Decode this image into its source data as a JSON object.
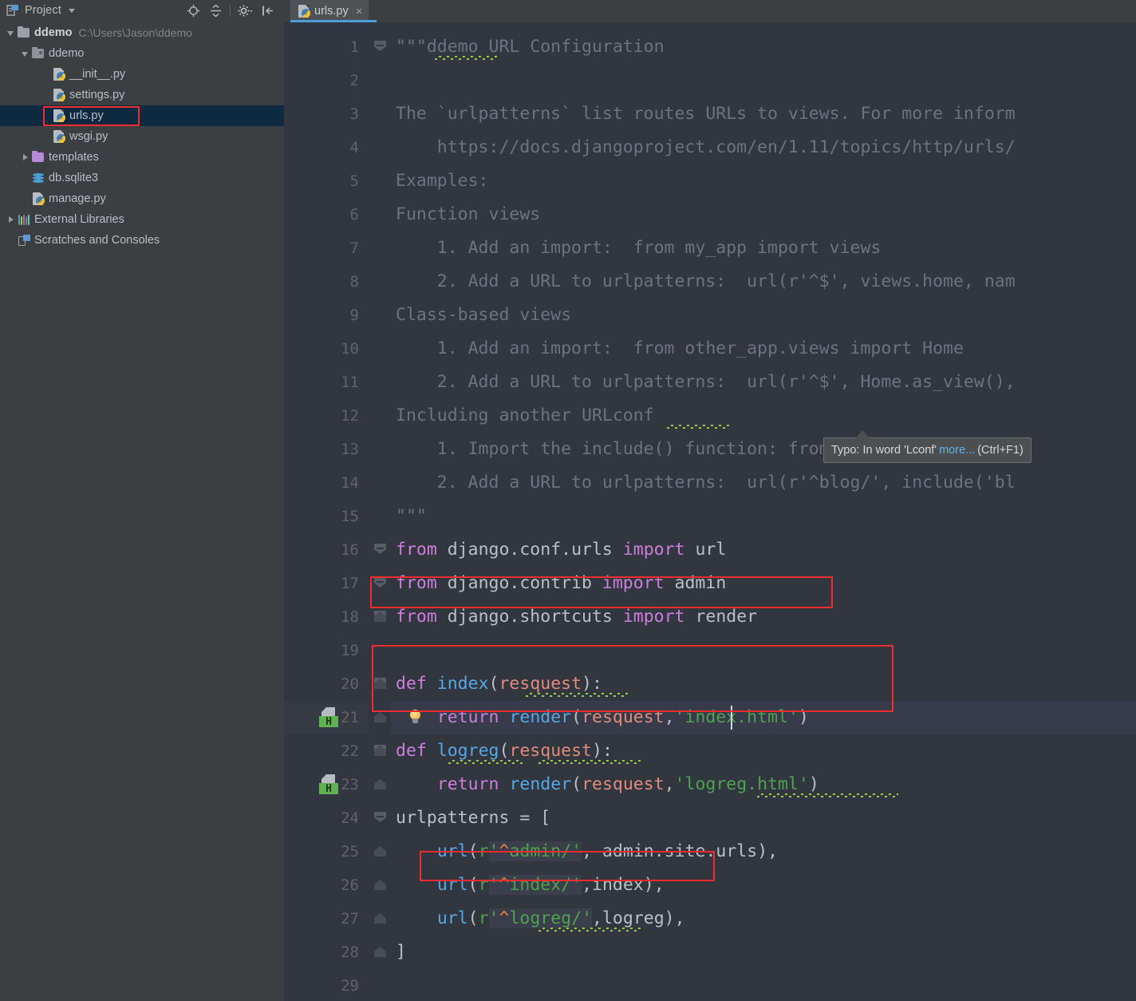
{
  "sidebar": {
    "header": {
      "title": "Project",
      "icon": "project-icon",
      "caret": "chevron-down-icon"
    },
    "toolbar_icons": [
      {
        "name": "locate-target-icon"
      },
      {
        "name": "collapse-all-icon"
      },
      {
        "name": "settings-gear-icon"
      },
      {
        "name": "hide-panel-icon"
      }
    ],
    "items": [
      {
        "label": "ddemo",
        "path": "C:\\Users\\Jason\\ddemo",
        "icon": "folder-icon",
        "indent": 0,
        "arrow": "down",
        "bold": true,
        "selected": false
      },
      {
        "label": "ddemo",
        "path": "",
        "icon": "module-folder-icon",
        "indent": 1,
        "arrow": "down",
        "bold": false,
        "selected": false
      },
      {
        "label": "__init__.py",
        "path": "",
        "icon": "python-file-icon",
        "indent": 2,
        "arrow": "none",
        "bold": false,
        "selected": false
      },
      {
        "label": "settings.py",
        "path": "",
        "icon": "python-file-icon",
        "indent": 2,
        "arrow": "none",
        "bold": false,
        "selected": false
      },
      {
        "label": "urls.py",
        "path": "",
        "icon": "python-file-icon",
        "indent": 2,
        "arrow": "none",
        "bold": false,
        "selected": true
      },
      {
        "label": "wsgi.py",
        "path": "",
        "icon": "python-file-icon",
        "indent": 2,
        "arrow": "none",
        "bold": false,
        "selected": false
      },
      {
        "label": "templates",
        "path": "",
        "icon": "templates-folder-icon",
        "indent": 1,
        "arrow": "right",
        "bold": false,
        "selected": false
      },
      {
        "label": "db.sqlite3",
        "path": "",
        "icon": "database-icon",
        "indent": 1,
        "arrow": "none",
        "bold": false,
        "selected": false
      },
      {
        "label": "manage.py",
        "path": "",
        "icon": "python-file-icon",
        "indent": 1,
        "arrow": "none",
        "bold": false,
        "selected": false
      },
      {
        "label": "External Libraries",
        "path": "",
        "icon": "libraries-icon",
        "indent": 0,
        "arrow": "right",
        "bold": false,
        "selected": false
      },
      {
        "label": "Scratches and Consoles",
        "path": "",
        "icon": "scratches-icon",
        "indent": 0,
        "arrow": "none",
        "bold": false,
        "selected": false
      }
    ]
  },
  "editor": {
    "tab": {
      "label": "urls.py",
      "icon": "python-file-icon",
      "close": "×"
    },
    "caret_line": 21,
    "lines": [
      {
        "n": 1,
        "text": "\"\"\"ddemo URL Configuration"
      },
      {
        "n": 2,
        "text": ""
      },
      {
        "n": 3,
        "text": "The `urlpatterns` list routes URLs to views. For more inform"
      },
      {
        "n": 4,
        "text": "    https://docs.djangoproject.com/en/1.11/topics/http/urls/"
      },
      {
        "n": 5,
        "text": "Examples:"
      },
      {
        "n": 6,
        "text": "Function views"
      },
      {
        "n": 7,
        "text": "    1. Add an import:  from my_app import views"
      },
      {
        "n": 8,
        "text": "    2. Add a URL to urlpatterns:  url(r'^$', views.home, nam"
      },
      {
        "n": 9,
        "text": "Class-based views"
      },
      {
        "n": 10,
        "text": "    1. Add an import:  from other_app.views import Home"
      },
      {
        "n": 11,
        "text": "    2. Add a URL to urlpatterns:  url(r'^$', Home.as_view(),"
      },
      {
        "n": 12,
        "text": "Including another URLconf"
      },
      {
        "n": 13,
        "text": "    1. Import the include() function: from django.conf.urls"
      },
      {
        "n": 14,
        "text": "    2. Add a URL to urlpatterns:  url(r'^blog/', include('bl"
      },
      {
        "n": 15,
        "text": "\"\"\""
      },
      {
        "n": 16,
        "text": "from django.conf.urls import url"
      },
      {
        "n": 17,
        "text": "from django.contrib import admin"
      },
      {
        "n": 18,
        "text": "from django.shortcuts import render"
      },
      {
        "n": 19,
        "text": ""
      },
      {
        "n": 20,
        "text": "def index(resquest):"
      },
      {
        "n": 21,
        "text": "    return render(resquest,'index.html')"
      },
      {
        "n": 22,
        "text": "def logreg(resquest):"
      },
      {
        "n": 23,
        "text": "    return render(resquest,'logreg.html')"
      },
      {
        "n": 24,
        "text": "urlpatterns = ["
      },
      {
        "n": 25,
        "text": "    url(r'^admin/', admin.site.urls),"
      },
      {
        "n": 26,
        "text": "    url(r'^index/',index),"
      },
      {
        "n": 27,
        "text": "    url(r'^logreg/',logreg),"
      },
      {
        "n": 28,
        "text": "]"
      },
      {
        "n": 29,
        "text": ""
      }
    ],
    "gutter_icons": [
      {
        "line": 21,
        "name": "html-file-reference-icon",
        "badge": "H"
      },
      {
        "line": 23,
        "name": "html-file-reference-icon",
        "badge": "H"
      }
    ],
    "intention_bulb": {
      "line": 21,
      "name": "intention-bulb-icon"
    },
    "colors": {
      "editor_bg": "#32363f",
      "gutter_bg": "#313640",
      "sidebar_bg": "#3c3f41",
      "selection_bg": "#0d2a41",
      "keyword": "#cc7eda",
      "function": "#54a8e8",
      "parameter": "#e08b7c",
      "string": "#4ea24e",
      "docstring": "#6c7380",
      "plain": "#a9b7c6",
      "annotation_red": "#ef2b2b",
      "tab_underline": "#4a9fd8",
      "typo_squiggle": "#9fd14a"
    }
  },
  "tooltip": {
    "prefix": "Typo: In word 'Lconf'",
    "link": "more...",
    "suffix": "(Ctrl+F1)"
  },
  "annotations": [
    {
      "name": "sidebar-urls-highlight"
    },
    {
      "name": "import-render-highlight"
    },
    {
      "name": "index-view-highlight"
    },
    {
      "name": "index-url-highlight"
    },
    {
      "name": "bulb-highlight"
    }
  ]
}
